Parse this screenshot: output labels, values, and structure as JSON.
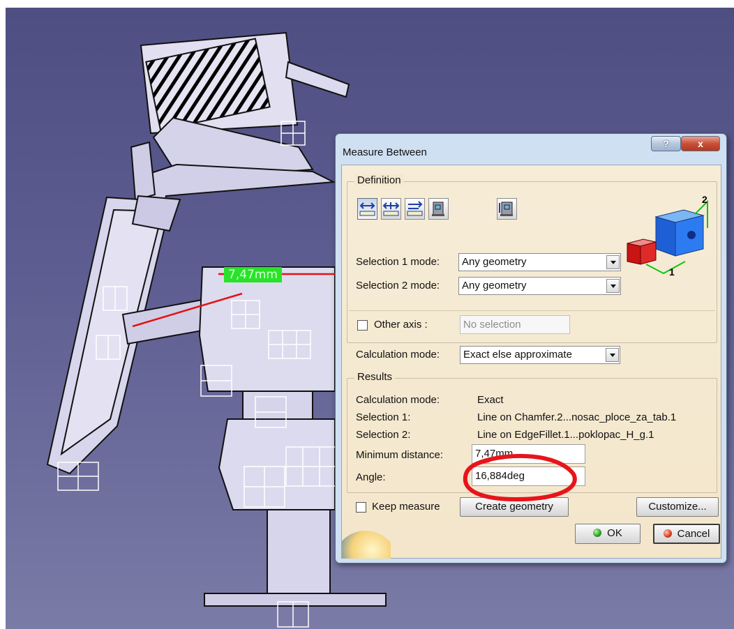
{
  "viewport": {
    "measure_label": "7,47mm"
  },
  "dialog": {
    "title": "Measure Between",
    "help_button": "?",
    "close_button": "x",
    "definition": {
      "group_label": "Definition",
      "toolbar_icons": [
        "measure-between-icon",
        "measure-in-chain-icon",
        "measure-in-fan-icon",
        "measure-item-icon",
        "measure-thickness-icon"
      ],
      "selection1_label": "Selection 1 mode:",
      "selection1_value": "Any geometry",
      "selection2_label": "Selection 2 mode:",
      "selection2_value": "Any geometry",
      "other_axis_label": "Other axis :",
      "other_axis_checked": false,
      "other_axis_value": "No selection",
      "calc_mode_label": "Calculation mode:",
      "calc_mode_value": "Exact else approximate",
      "preview_labels": [
        "1",
        "2"
      ]
    },
    "results": {
      "group_label": "Results",
      "calc_mode_label": "Calculation mode:",
      "calc_mode_value": "Exact",
      "selection1_label": "Selection 1:",
      "selection1_value": "Line on Chamfer.2...nosac_ploce_za_tab.1",
      "selection2_label": "Selection 2:",
      "selection2_value": "Line on EdgeFillet.1...poklopac_H_g.1",
      "min_distance_label": "Minimum distance:",
      "min_distance_value": "7,47mm",
      "angle_label": "Angle:",
      "angle_value": "16,884deg"
    },
    "keep_measure_label": "Keep measure",
    "keep_measure_checked": false,
    "create_geometry_button": "Create geometry",
    "customize_button": "Customize...",
    "ok_button": "OK",
    "cancel_button": "Cancel",
    "highlight_color": "#e8141b"
  }
}
